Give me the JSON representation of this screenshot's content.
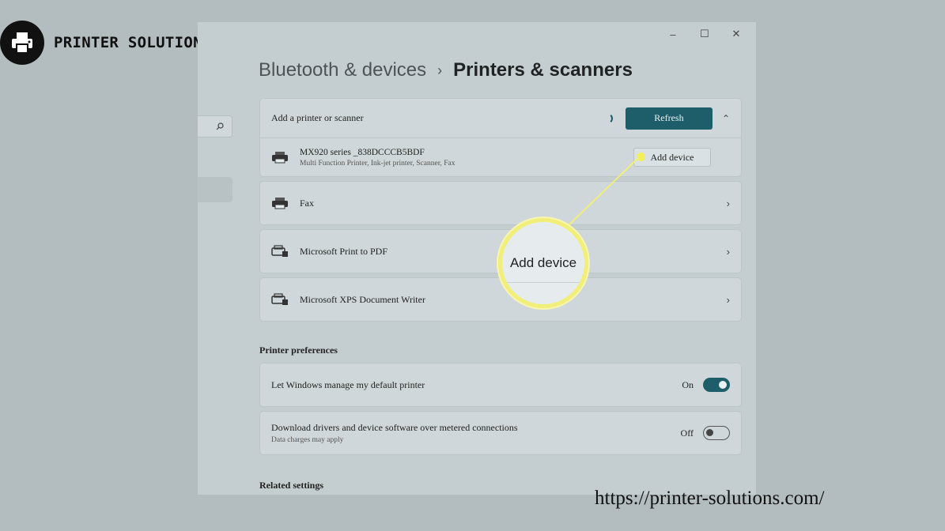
{
  "brand": {
    "name": "PRINTER SOLUTIONS",
    "icon": "printer-icon"
  },
  "window": {
    "controls": [
      "–",
      "☐",
      "✕"
    ]
  },
  "breadcrumb": {
    "parent": "Bluetooth & devices",
    "separator": "›",
    "current": "Printers & scanners"
  },
  "add_printer": {
    "label": "Add a printer or scanner",
    "refresh_label": "Refresh",
    "found_device": {
      "name": "MX920 series _838DCCCB5BDF",
      "description": "Multi Function Printer, Ink-jet printer, Scanner, Fax",
      "add_label": "Add device"
    }
  },
  "printers": [
    {
      "name": "Fax"
    },
    {
      "name": "Microsoft Print to PDF"
    },
    {
      "name": "Microsoft XPS Document Writer"
    }
  ],
  "preferences": {
    "heading": "Printer preferences",
    "items": [
      {
        "label": "Let Windows manage my default printer",
        "sub": "",
        "state": "On"
      },
      {
        "label": "Download drivers and device software over metered connections",
        "sub": "Data charges may apply",
        "state": "Off"
      }
    ]
  },
  "related": {
    "heading": "Related settings"
  },
  "callout": {
    "text": "Add device",
    "color": "#f1ef7a"
  },
  "footer": {
    "url": "https://printer-solutions.com/"
  },
  "colors": {
    "accent": "#1e5d6a",
    "background": "#b3bcbf"
  }
}
